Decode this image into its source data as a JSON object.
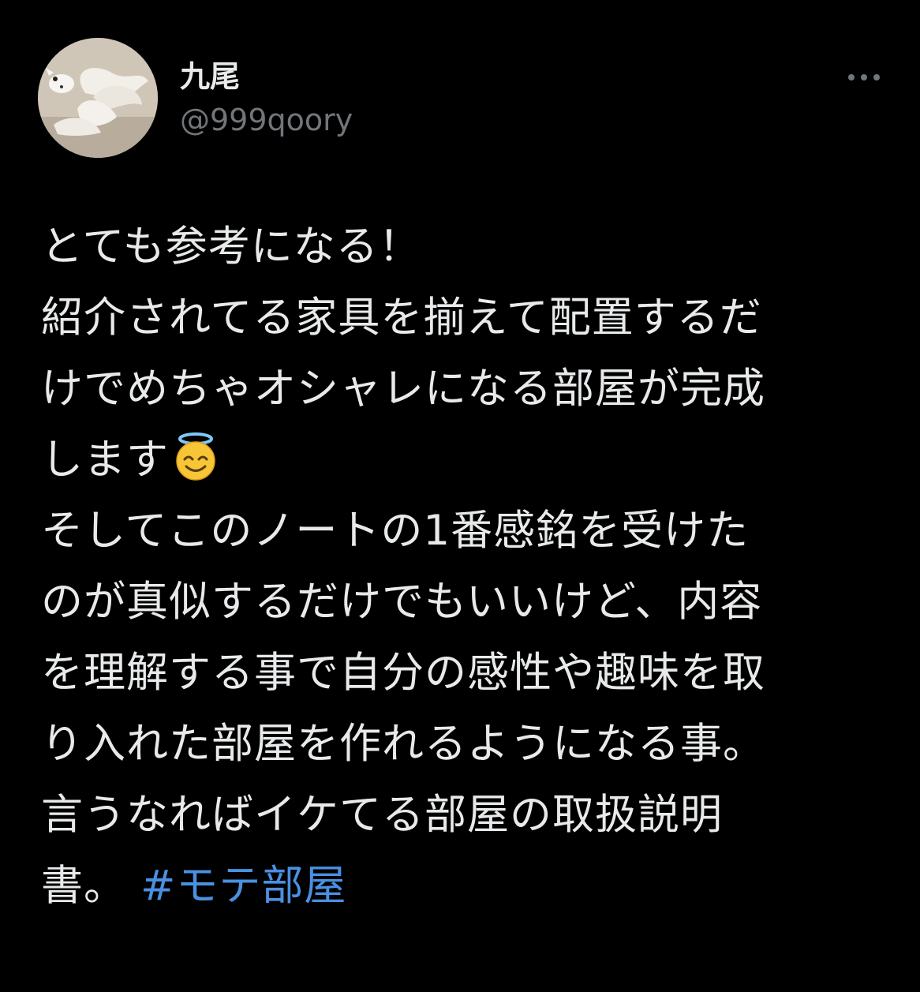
{
  "user": {
    "display_name": "九尾",
    "handle": "@999qoory"
  },
  "tweet": {
    "lines": [
      "とても参考になる！",
      "紹介されてる家具を揃えて配置するだ",
      "けでめちゃオシャレになる部屋が完成",
      "します",
      "そしてこのノートの1番感銘を受けた",
      "のが真似するだけでもいいけど、内容",
      "を理解する事で自分の感性や趣味を取",
      "り入れた部屋を作れるようになる事。",
      "言うなればイケてる部屋の取扱説明",
      "書。"
    ],
    "hashtag": "#モテ部屋",
    "emoji": "smiling-face-with-halo"
  },
  "colors": {
    "background": "#000000",
    "text": "#e7e9ea",
    "secondary": "#71767b",
    "link": "#4a90e2"
  },
  "icons": {
    "more": "more-horizontal-icon"
  }
}
